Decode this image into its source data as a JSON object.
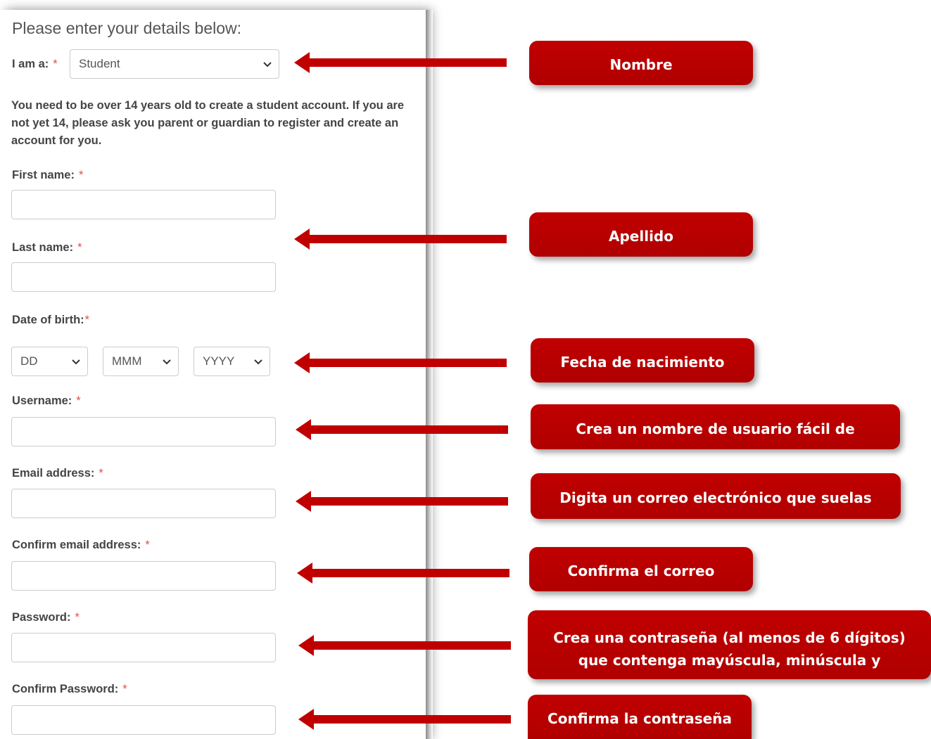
{
  "form": {
    "title": "Please enter your details below:",
    "i_am": {
      "label": "I am a:",
      "required": "*",
      "value": "Student"
    },
    "note": "You need to be over 14 years old to create a student account. If you are not yet 14, please ask you parent or guardian to register and create an account for you.",
    "first_name": {
      "label": "First name:",
      "required": "*"
    },
    "last_name": {
      "label": "Last name:",
      "required": "*"
    },
    "dob": {
      "label": "Date of birth:",
      "required": "*",
      "day": "DD",
      "month": "MMM",
      "year": "YYYY"
    },
    "username": {
      "label": "Username:",
      "required": "*"
    },
    "email": {
      "label": "Email address:",
      "required": "*"
    },
    "confirm_email": {
      "label": "Confirm email address:",
      "required": "*"
    },
    "password": {
      "label": "Password:",
      "required": "*"
    },
    "confirm_password": {
      "label": "Confirm Password:",
      "required": "*"
    }
  },
  "callouts": {
    "nombre": "Nombre",
    "apellido": "Apellido",
    "fecha": "Fecha de nacimiento",
    "usuario": "Crea un nombre de usuario fácil de",
    "correo": "Digita un correo electrónico que suelas",
    "confirma_correo": "Confirma el correo",
    "contrasena_line1": "Crea una contraseña (al menos de 6 dígitos)",
    "contrasena_line2": "que contenga mayúscula, minúscula y",
    "confirma_contrasena": "Confirma la contraseña"
  },
  "colors": {
    "accent": "#c00000",
    "required": "#d9534f"
  },
  "icons": {
    "arrow": "arrow-left-icon",
    "dropdown": "chevron-down-icon"
  }
}
